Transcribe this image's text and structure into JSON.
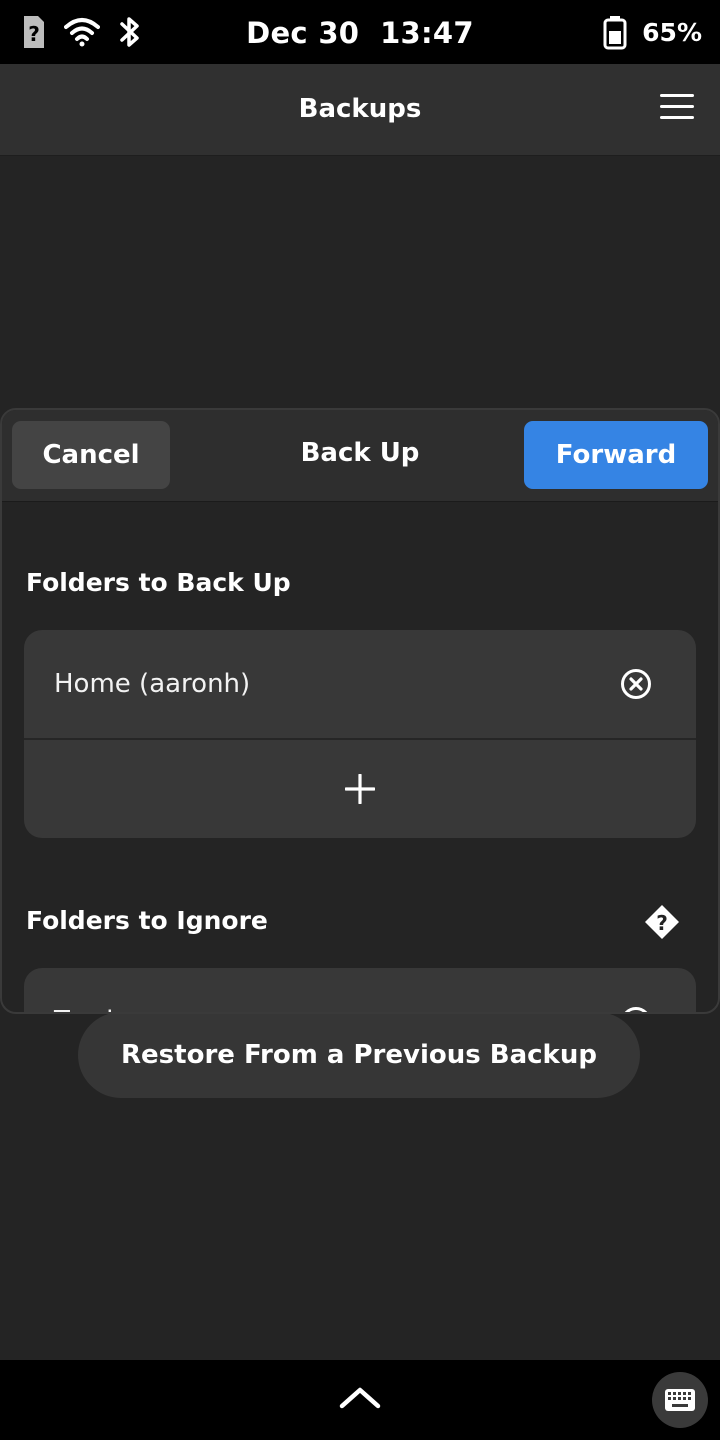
{
  "status_bar": {
    "date": "Dec 30",
    "time": "13:47",
    "battery_percent": "65%",
    "icons": [
      "sim-unknown-icon",
      "wifi-icon",
      "bluetooth-icon",
      "battery-icon"
    ]
  },
  "header": {
    "title": "Backups",
    "menu_icon": "hamburger-menu-icon"
  },
  "background": {
    "restore_button": "Restore From a Previous Backup"
  },
  "dialog": {
    "cancel_label": "Cancel",
    "title": "Back Up",
    "forward_label": "Forward",
    "forward_color": "#3584e4",
    "folders_to_back_up": {
      "title": "Folders to Back Up",
      "items": [
        {
          "label": "Home (aaronh)",
          "icon": "remove-circle-icon"
        }
      ],
      "add_icon": "plus-icon"
    },
    "folders_to_ignore": {
      "title": "Folders to Ignore",
      "help_icon": "help-diamond-icon",
      "items": [
        {
          "label": "Trash",
          "icon": "remove-circle-icon"
        }
      ]
    }
  },
  "bottom_bar": {
    "icons": [
      "chevron-up-icon",
      "keyboard-icon"
    ]
  }
}
